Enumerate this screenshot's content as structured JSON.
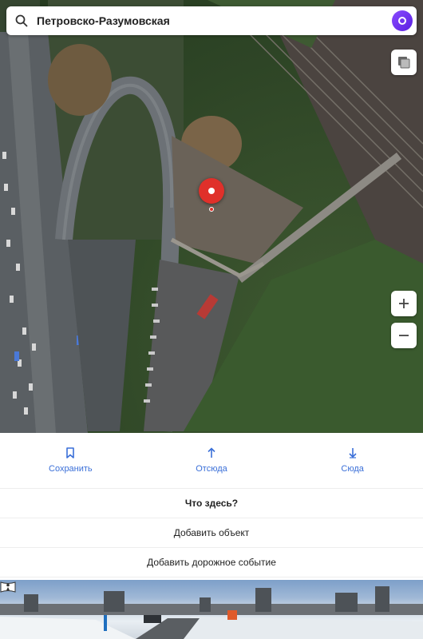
{
  "search": {
    "query": "Петровско-Разумовская"
  },
  "map_controls": {
    "layers": "layers-icon",
    "zoom_in": "plus-icon",
    "zoom_out": "minus-icon"
  },
  "actions": [
    {
      "label": "Сохранить",
      "icon": "bookmark-icon"
    },
    {
      "label": "Отсюда",
      "icon": "arrow-up-icon"
    },
    {
      "label": "Сюда",
      "icon": "arrow-down-icon"
    }
  ],
  "menu": {
    "what_here": "Что здесь?",
    "add_object": "Добавить объект",
    "add_road_event": "Добавить дорожное событие"
  },
  "colors": {
    "accent": "#3a6fd8",
    "pin": "#e0302a",
    "alice": "#6a2cf0"
  }
}
